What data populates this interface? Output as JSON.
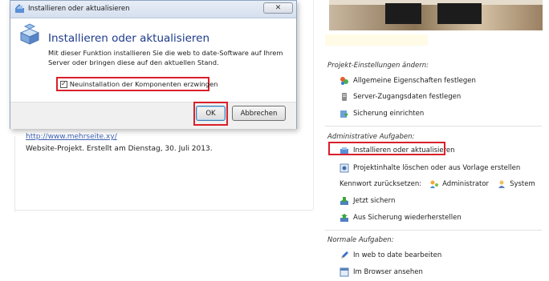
{
  "background_left": {
    "link_text": "http://www.mehrseite.xy/",
    "description": "Website-Projekt. Erstellt am Dienstag, 30. Juli 2013."
  },
  "dialog": {
    "title": "Installieren oder aktualisieren",
    "heading": "Installieren oder aktualisieren",
    "text_line1": "Mit dieser Funktion installieren Sie die web to date-Software auf Ihrem",
    "text_line2": "Server oder bringen diese auf den aktuellen Stand.",
    "checkbox_label": "Neuinstallation der Komponenten erzwingen",
    "checkbox_checked": true,
    "checkbox_mark": "✓",
    "close_symbol": "✕",
    "ok_label": "OK",
    "cancel_label": "Abbrechen"
  },
  "sections": {
    "projekt": {
      "title": "Projekt-Einstellungen ändern:",
      "items": [
        {
          "label": "Allgemeine Eigenschaften festlegen",
          "icon": "properties-icon"
        },
        {
          "label": "Server-Zugangsdaten festlegen",
          "icon": "server-icon"
        },
        {
          "label": "Sicherung einrichten",
          "icon": "backup-setup-icon"
        }
      ]
    },
    "admin": {
      "title": "Administrative Aufgaben:",
      "items": [
        {
          "label": "Installieren oder aktualisieren",
          "icon": "install-icon"
        },
        {
          "label": "Projektinhalte löschen oder aus Vorlage erstellen",
          "icon": "delete-content-icon"
        },
        {
          "label": "Kennwort zurücksetzen:",
          "icon": ""
        },
        {
          "label": "Jetzt sichern",
          "icon": "save-now-icon"
        },
        {
          "label": "Aus Sicherung wiederherstellen",
          "icon": "restore-icon"
        }
      ],
      "kennwort_users": [
        "Administrator",
        "System"
      ]
    },
    "normal": {
      "title": "Normale Aufgaben:",
      "items": [
        {
          "label": "In web to date bearbeiten",
          "icon": "edit-pen-icon"
        },
        {
          "label": "Im Browser ansehen",
          "icon": "browser-icon"
        }
      ]
    }
  },
  "colors": {
    "highlight": "#d9202a",
    "heading_blue": "#1c3a8c",
    "link_blue": "#3b5fb0"
  }
}
